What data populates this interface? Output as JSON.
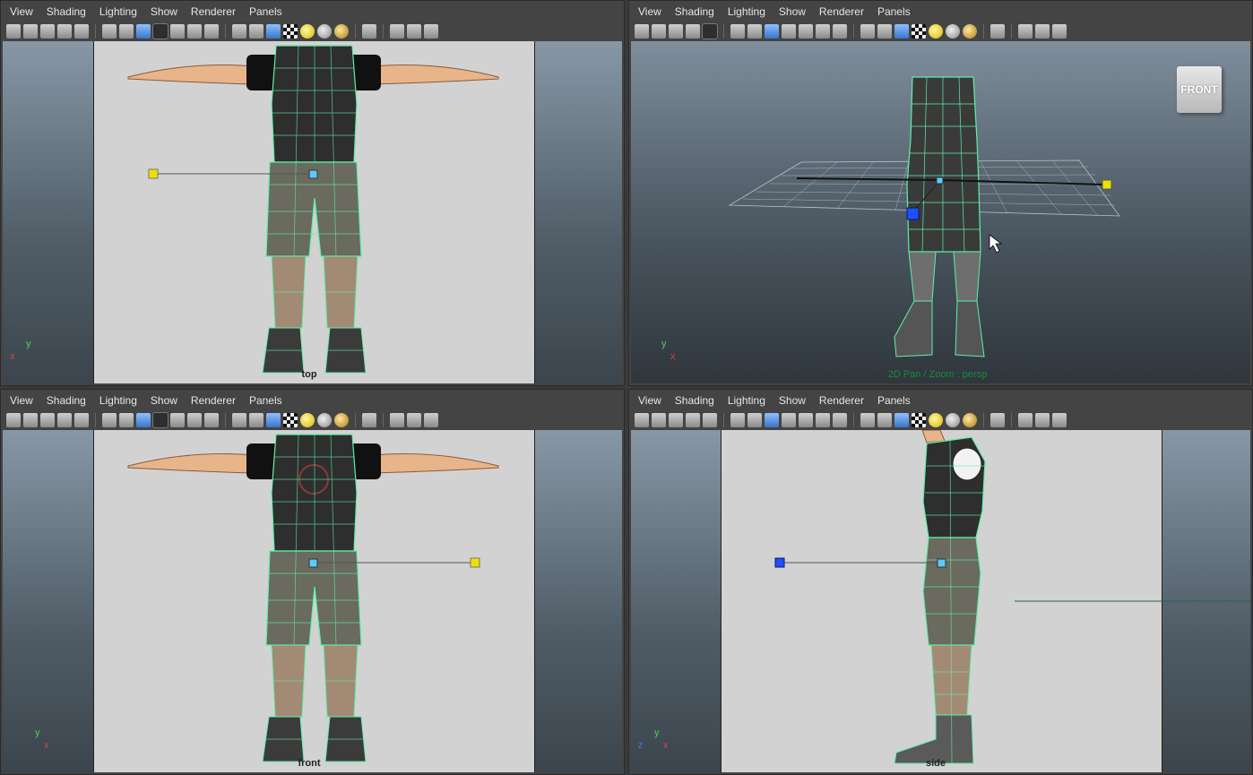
{
  "menus": [
    "View",
    "Shading",
    "Lighting",
    "Show",
    "Renderer",
    "Panels"
  ],
  "panels": {
    "top": {
      "camera_label": "top"
    },
    "persp": {
      "viewcube_label": "FRONT",
      "status_text": "2D Pan / Zoom : persp"
    },
    "front": {
      "camera_label": "front"
    },
    "side": {
      "camera_label": "side"
    }
  },
  "axes": {
    "x": "x",
    "y": "y",
    "z": "z"
  },
  "icons": [
    "camera-icon",
    "camera-attr-icon",
    "bookmark-icon",
    "image-plane-icon",
    "2d-pan-icon",
    "grid-icon",
    "film-gate-icon",
    "resolution-gate-icon",
    "gate-mask-icon",
    "field-chart-icon",
    "safe-action-icon",
    "safe-title-icon",
    "wireframe-icon",
    "smooth-shade-icon",
    "textured-icon",
    "checker-icon",
    "default-light-icon",
    "shadow-icon",
    "ambient-occlusion-icon",
    "isolate-select-icon",
    "xray-icon",
    "xray-joints-icon",
    "xray-components-icon"
  ]
}
